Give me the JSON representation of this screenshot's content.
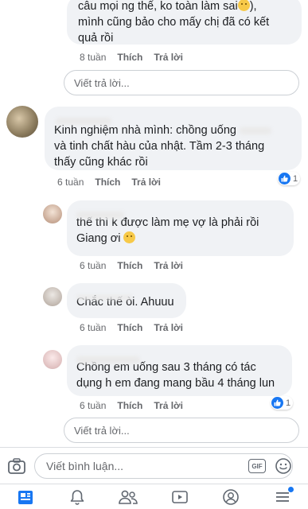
{
  "comments": [
    {
      "text_line1": "câu mọi ng thế, ko toàn làm sai",
      "text_line1_end": "),",
      "text_line2": "mình cũng bảo cho mấy chị đã có kết",
      "text_line3": "quả rồi",
      "time": "8 tuần",
      "like": "Thích",
      "reply": "Trả lời"
    },
    {
      "text_line1": "Kinh nghiệm nhà mình: chồng uống",
      "text_line2": "và tinh chất hàu của nhật. Tầm 2-3 tháng",
      "text_line3": "thấy cũng khác rồi",
      "time": "6 tuần",
      "like": "Thích",
      "reply": "Trả lời",
      "reactions": "1"
    },
    {
      "text_line1": "thế thì k được làm mẹ vợ là phải rồi",
      "text_line2": "Giang ơi",
      "time": "6 tuần",
      "like": "Thích",
      "reply": "Trả lời"
    },
    {
      "text_line1": "Chắc thế òi. Ahuuu",
      "time": "6 tuần",
      "like": "Thích",
      "reply": "Trả lời"
    },
    {
      "text_line1": "Chồng em uống sau 3 tháng có tác",
      "text_line2": "dụng h em đang mang bầu 4 tháng lun",
      "time": "6 tuần",
      "like": "Thích",
      "reply": "Trả lời",
      "reactions": "1"
    }
  ],
  "reply_placeholder_1": "Viết trả lời...",
  "reply_placeholder_2": "Viết trả lời...",
  "composer": {
    "placeholder": "Viết bình luận...",
    "gif_label": "GIF"
  },
  "colors": {
    "accent": "#1877f2",
    "bubble": "#f0f2f5",
    "meta_text": "#65676b",
    "notification_dot": "#1877f2"
  },
  "icons": [
    "camera-icon",
    "gif-icon",
    "emoji-icon",
    "news-feed-icon",
    "bell-icon",
    "friends-icon",
    "watch-icon",
    "profile-icon",
    "menu-icon",
    "like-icon"
  ]
}
